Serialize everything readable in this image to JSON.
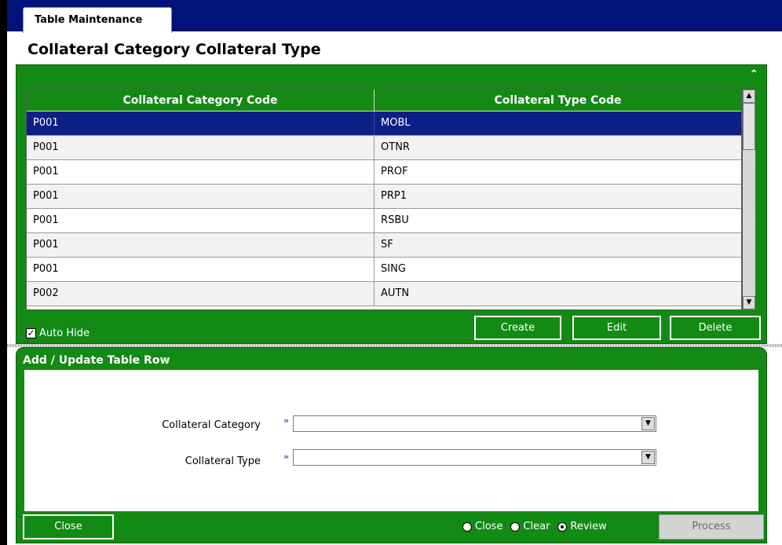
{
  "tab": {
    "label": "Table Maintenance"
  },
  "page": {
    "title": "Collateral Category Collateral Type"
  },
  "grid": {
    "columns": [
      "Collateral Category Code",
      "Collateral Type Code"
    ],
    "rows": [
      [
        "P001",
        "MOBL"
      ],
      [
        "P001",
        "OTNR"
      ],
      [
        "P001",
        "PROF"
      ],
      [
        "P001",
        "PRP1"
      ],
      [
        "P001",
        "RSBU"
      ],
      [
        "P001",
        "SF"
      ],
      [
        "P001",
        "SING"
      ],
      [
        "P002",
        "AUTN"
      ]
    ],
    "selected_row": 0,
    "collapse_icon": "double-chevron-up-icon"
  },
  "auto_hide": {
    "label": "Auto Hide",
    "checked": true
  },
  "grid_buttons": {
    "create": "Create",
    "edit": "Edit",
    "delete": "Delete"
  },
  "form": {
    "title": "Add / Update Table Row",
    "fields": {
      "category": {
        "label": "Collateral Category",
        "value": ""
      },
      "type": {
        "label": "Collateral Type",
        "value": ""
      }
    }
  },
  "footer": {
    "close_label": "Close",
    "radios": [
      {
        "label": "Close",
        "checked": false
      },
      {
        "label": "Clear",
        "checked": false
      },
      {
        "label": "Review",
        "checked": true
      }
    ],
    "process_label": "Process"
  },
  "colors": {
    "nav": "#03127a",
    "panel": "#138a14",
    "selection": "#0e1f85"
  }
}
